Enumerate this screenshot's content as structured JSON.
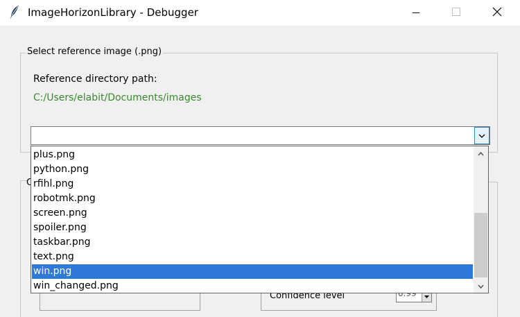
{
  "window": {
    "title": "ImageHorizonLibrary - Debugger",
    "app_icon": "feather-icon",
    "controls": [
      "minimize-icon",
      "maximize-icon",
      "close-icon"
    ]
  },
  "reference_group": {
    "title": "Select reference image (.png)",
    "dir_label": "Reference directory path:",
    "dir_path": "C:/Users/elabit/Documents/images",
    "combo_value": ""
  },
  "dropdown": {
    "items": [
      "plus.png",
      "python.png",
      "rfihl.png",
      "robotmk.png",
      "screen.png",
      "spoiler.png",
      "taskbar.png",
      "text.png",
      "win.png",
      "win_changed.png"
    ],
    "selected": "win.png"
  },
  "second_group": {
    "title_visible": "C",
    "confidence_label": "Confidence level",
    "confidence_value": "0.99"
  },
  "colors": {
    "path_text": "#3a8a2e",
    "selection": "#3079d7",
    "background": "#f0f0f0"
  }
}
